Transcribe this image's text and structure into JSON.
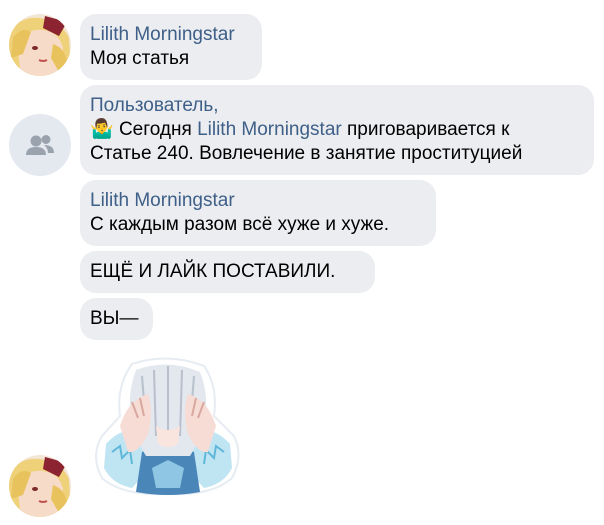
{
  "messages": [
    {
      "sender": "Lilith Morningstar",
      "text": "Моя статья"
    },
    {
      "sender": "Пользователь,",
      "line1_emoji": "🤷‍♂️",
      "line1_prefix": " Сегодня ",
      "line1_mention": "Lilith Morningstar",
      "line1_suffix": " приговаривается к",
      "line2": "Статье 240. Вовлечение в занятие проституцией"
    },
    {
      "sender": "Lilith Morningstar",
      "text": "С каждым разом всё хуже и хуже."
    },
    {
      "text": "ЕЩЁ И ЛАЙК ПОСТАВИЛИ."
    },
    {
      "text": "ВЫ—"
    }
  ],
  "icons": {
    "group_avatar": "users-icon",
    "sticker": "facepalm-anime-girl-sticker"
  },
  "colors": {
    "bubble": "#ebedf0",
    "sender_name": "#3e5f88",
    "text": "#000000",
    "group_avatar_bg": "#e4e9f0",
    "group_icon": "#99a2ad"
  }
}
